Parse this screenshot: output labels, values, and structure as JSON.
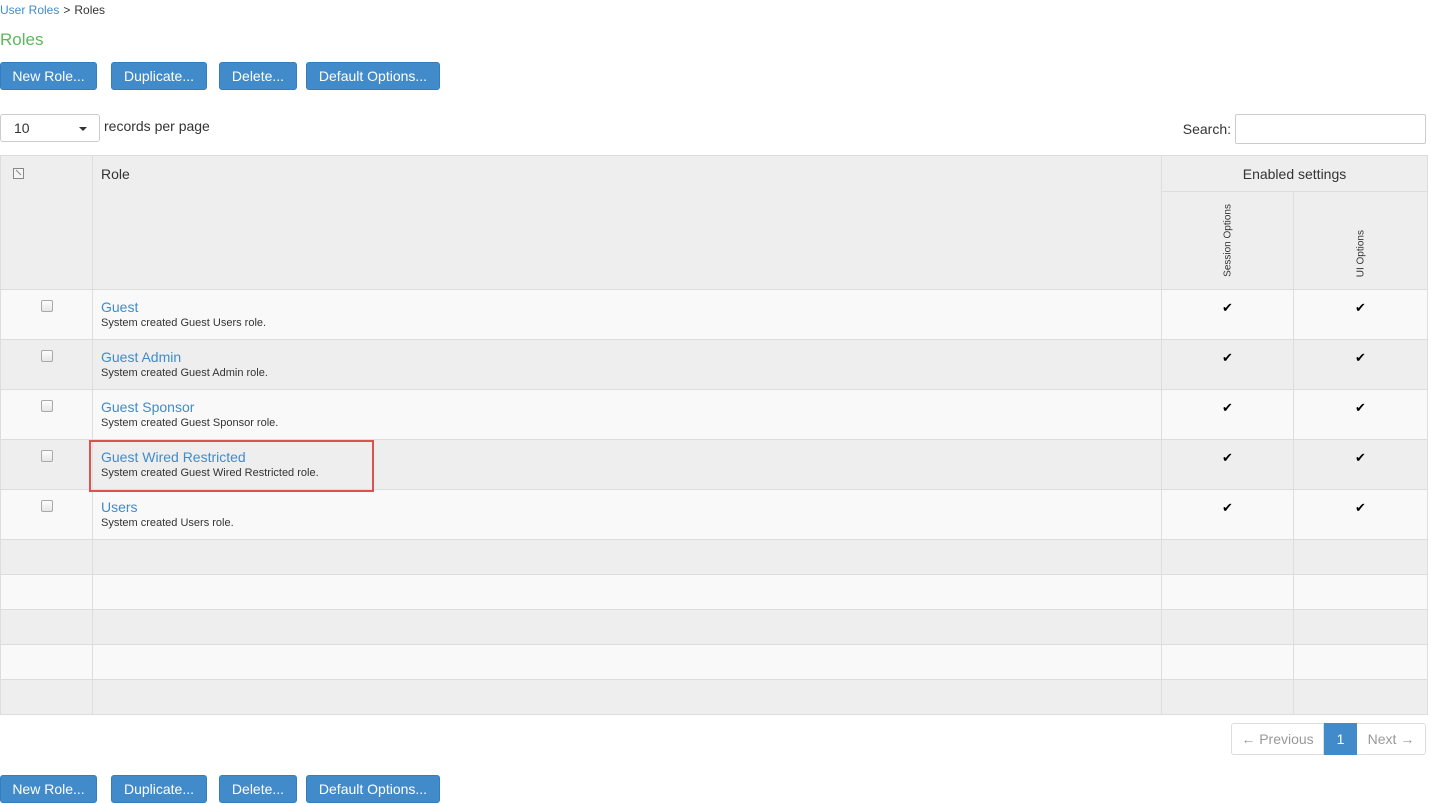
{
  "breadcrumb": {
    "parent": "User Roles",
    "separator": ">",
    "current": "Roles"
  },
  "page_title": "Roles",
  "actions": {
    "new_role": "New Role...",
    "duplicate": "Duplicate...",
    "delete": "Delete...",
    "default_options": "Default Options..."
  },
  "per_page": {
    "value": "10",
    "label": "records per page"
  },
  "search": {
    "label": "Search:",
    "placeholder": ""
  },
  "table": {
    "headers": {
      "role": "Role",
      "enabled_settings": "Enabled settings",
      "session_options": "Session Options",
      "ui_options": "UI Options"
    },
    "rows": [
      {
        "name": "Guest",
        "description": "System created Guest Users role.",
        "session_options": "✔",
        "ui_options": "✔"
      },
      {
        "name": "Guest Admin",
        "description": "System created Guest Admin role.",
        "session_options": "✔",
        "ui_options": "✔"
      },
      {
        "name": "Guest Sponsor",
        "description": "System created Guest Sponsor role.",
        "session_options": "✔",
        "ui_options": "✔"
      },
      {
        "name": "Guest Wired Restricted",
        "description": "System created Guest Wired Restricted role.",
        "session_options": "✔",
        "ui_options": "✔"
      },
      {
        "name": "Users",
        "description": "System created Users role.",
        "session_options": "✔",
        "ui_options": "✔"
      }
    ]
  },
  "pagination": {
    "previous": "← Previous",
    "current": "1",
    "next": "Next →"
  },
  "highlighted_row": "Guest Wired Restricted",
  "colors": {
    "primary": "#428bca",
    "title_green": "#5cb85c",
    "highlight_red": "#d9534f"
  }
}
